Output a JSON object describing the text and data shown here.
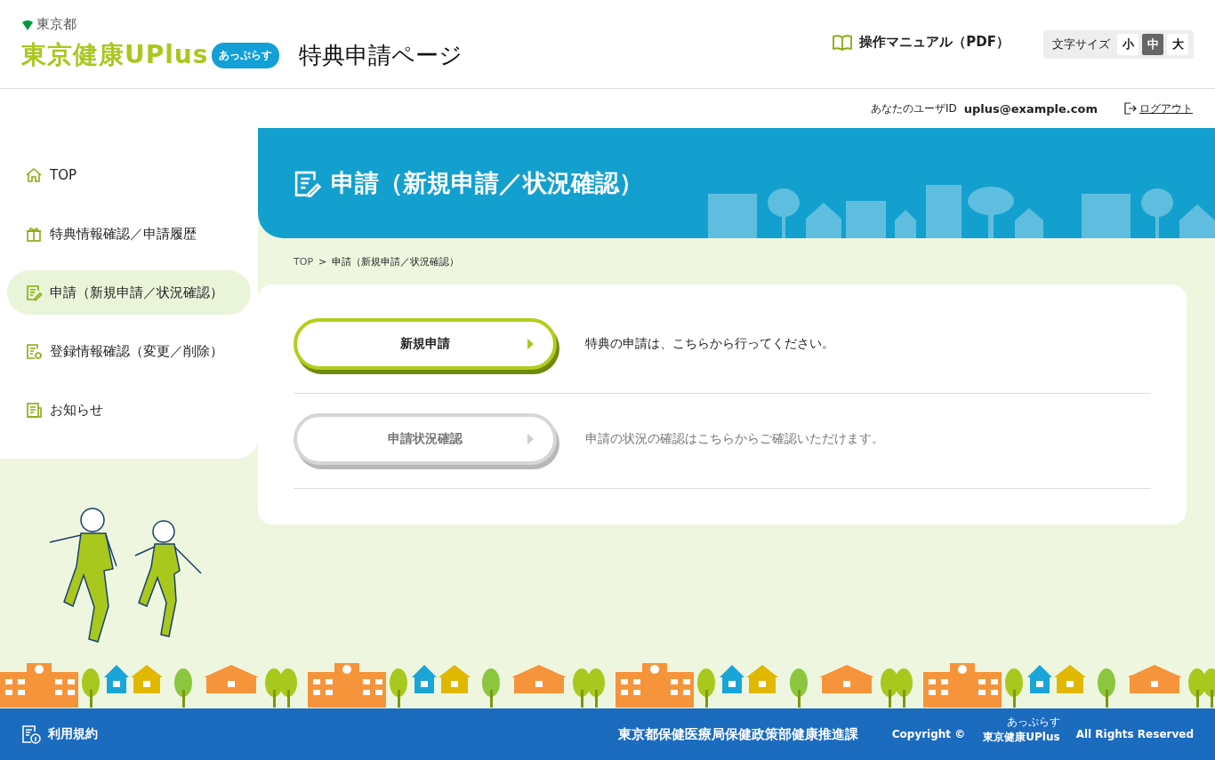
{
  "header": {
    "org": "東京都",
    "logo": {
      "text": "東京健康UPlus",
      "badge": "あっぷらす"
    },
    "page_title": "特典申請ページ",
    "manual_link": "操作マニュアル（PDF）",
    "font_size": {
      "label": "文字サイズ",
      "options": [
        {
          "label": "小",
          "selected": false
        },
        {
          "label": "中",
          "selected": true
        },
        {
          "label": "大",
          "selected": false
        }
      ]
    }
  },
  "user_bar": {
    "label": "あなたのユーザID",
    "user_id": "uplus@example.com",
    "logout": "ログアウト"
  },
  "sidebar": {
    "items": [
      {
        "label": "TOP",
        "selected": false
      },
      {
        "label": "特典情報確認／申請履歴",
        "selected": false
      },
      {
        "label": "申請（新規申請／状況確認）",
        "selected": true
      },
      {
        "label": "登録情報確認（変更／削除）",
        "selected": false
      },
      {
        "label": "お知らせ",
        "selected": false
      }
    ]
  },
  "hero": {
    "title": "申請（新規申請／状況確認）"
  },
  "breadcrumb": {
    "separator": ">",
    "items": [
      {
        "label": "TOP",
        "link": true
      },
      {
        "label": "申請（新規申請／状況確認）",
        "link": false
      }
    ]
  },
  "actions": [
    {
      "button": "新規申請",
      "description": "特典の申請は、こちらから行ってください。",
      "disabled": false
    },
    {
      "button": "申請状況確認",
      "description": "申請の状況の確認はこちらからご確認いただけます。",
      "disabled": true
    }
  ],
  "footer": {
    "terms": "利用規約",
    "department": "東京都保健医療局保健政策部健康推進課",
    "copyright": "Copyright ©",
    "brand": "東京健康UPlus",
    "brand_ruby": "あっぷらす",
    "rights": "All Rights Reserved"
  }
}
